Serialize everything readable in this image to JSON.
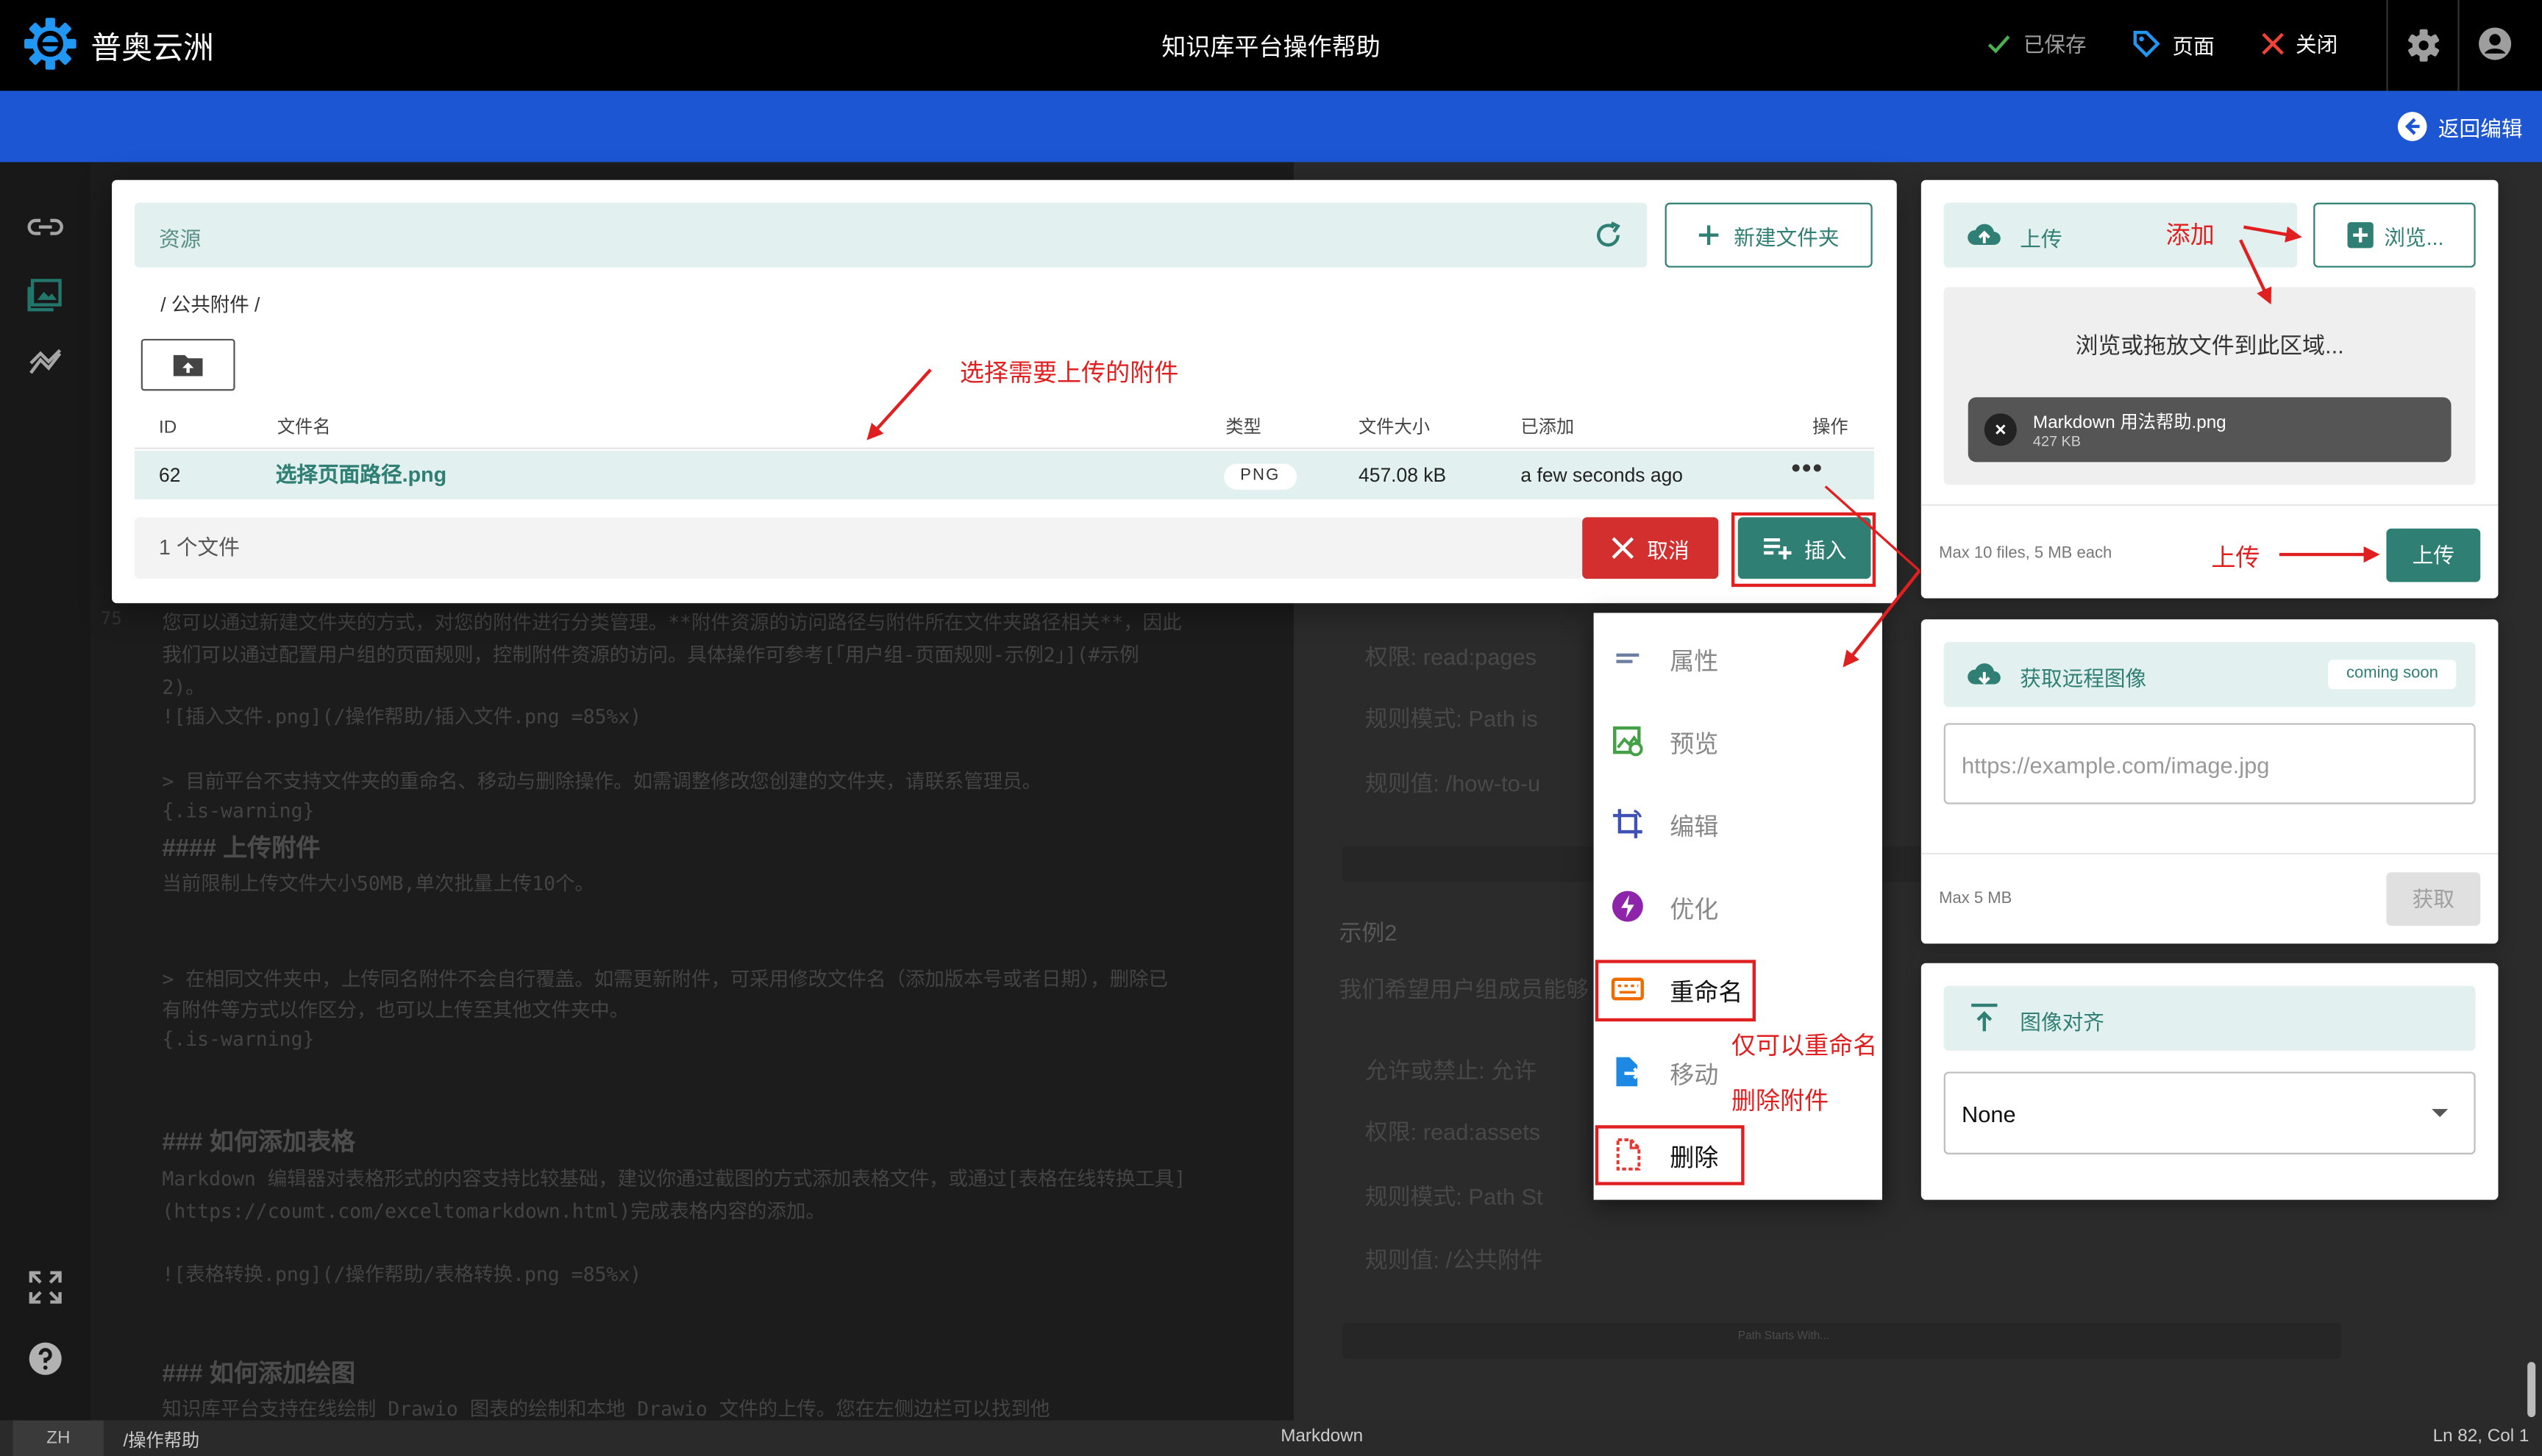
{
  "app": {
    "brand": "普奥云洲",
    "title": "知识库平台操作帮助"
  },
  "header_actions": {
    "saved": "已保存",
    "page": "页面",
    "close": "关闭"
  },
  "subbar": {
    "back_edit": "返回编辑"
  },
  "colors": {
    "accent": "#2f7f74",
    "accent_light": "#e2f1ef",
    "blue_bar": "#1c56d3",
    "danger": "#d32f2f",
    "annotation": "#e02020"
  },
  "editor": {
    "lines": [
      "您可以通过新建文件夹的方式，对您的附件进行分类管理。**附件资源的访问路径与附件所在文件夹路径相关**，因此",
      "我们可以通过配置用户组的页面规则，控制附件资源的访问。具体操作可参考[「用户组-页面规则-示例2」](#示例",
      "2)。",
      "![插入文件.png](/操作帮助/插入文件.png =85%x)",
      "> 目前平台不支持文件夹的重命名、移动与删除操作。如需调整修改您创建的文件夹，请联系管理员。",
      "{.is-warning}",
      "#### 上传附件",
      "当前限制上传文件大小50MB,单次批量上传10个。",
      "> 在相同文件夹中，上传同名附件不会自行覆盖。如需更新附件，可采用修改文件名（添加版本号或者日期），删除已",
      "有附件等方式以作区分，也可以上传至其他文件夹中。",
      "{.is-warning}",
      "### 如何添加表格",
      "Markdown 编辑器对表格形式的内容支持比较基础，建议你通过截图的方式添加表格文件，或通过[表格在线转换工具]",
      "(https://coumt.com/exceltomarkdown.html)完成表格内容的添加。",
      "![表格转换.png](/操作帮助/表格转换.png =85%x)",
      "### 如何添加绘图",
      "知识库平台支持在线绘制 Drawio 图表的绘制和本地 Drawio 文件的上传。您在左侧边栏可以找到他"
    ]
  },
  "preview": {
    "lines": [
      "权限:  read:pages",
      "规则模式:  Path is",
      "规则值:  /how-to-u",
      "示例2",
      "我们希望用户组成员能够",
      "允许或禁止:  允许",
      "权限:  read:assets",
      "规则模式:  Path St",
      "规则值:  /公共附件"
    ],
    "strip_text": "Path Starts With..."
  },
  "status_bar": {
    "lang": "ZH",
    "path": "/操作帮助",
    "mode": "Markdown",
    "cursor": "Ln 82, Col 1"
  },
  "dialog": {
    "resources_label": "资源",
    "new_folder": "新建文件夹",
    "breadcrumb": "/ 公共附件 /",
    "columns": {
      "id": "ID",
      "filename": "文件名",
      "type": "类型",
      "size": "文件大小",
      "added": "已添加",
      "actions": "操作"
    },
    "rows": [
      {
        "id": "62",
        "filename": "选择页面路径.png",
        "type": "PNG",
        "size": "457.08 kB",
        "added": "a few seconds ago"
      }
    ],
    "file_count": "1 个文件",
    "cancel": "取消",
    "insert": "插入"
  },
  "context_menu": {
    "items": [
      {
        "label": "属性",
        "icon": "properties-icon"
      },
      {
        "label": "预览",
        "icon": "preview-icon"
      },
      {
        "label": "编辑",
        "icon": "crop-edit-icon"
      },
      {
        "label": "优化",
        "icon": "lightning-icon"
      },
      {
        "label": "重命名",
        "icon": "keyboard-icon"
      },
      {
        "label": "移动",
        "icon": "move-file-icon"
      },
      {
        "label": "删除",
        "icon": "delete-file-icon"
      }
    ]
  },
  "upload_panel": {
    "title": "上传",
    "browse": "浏览...",
    "dropzone_text": "浏览或拖放文件到此区域...",
    "file_name": "Markdown 用法帮助.png",
    "file_size": "427 KB",
    "limit_note": "Max 10 files, 5 MB each",
    "upload_button": "上传"
  },
  "remote_panel": {
    "title": "获取远程图像",
    "badge": "coming soon",
    "url_placeholder": "https://example.com/image.jpg",
    "limit_note": "Max 5 MB",
    "fetch_button": "获取"
  },
  "align_panel": {
    "title": "图像对齐",
    "selected": "None"
  },
  "annotations": {
    "select_file": "选择需要上传的附件",
    "add": "添加",
    "upload": "上传",
    "rename_only": "仅可以重命名",
    "delete_file": "删除附件"
  }
}
